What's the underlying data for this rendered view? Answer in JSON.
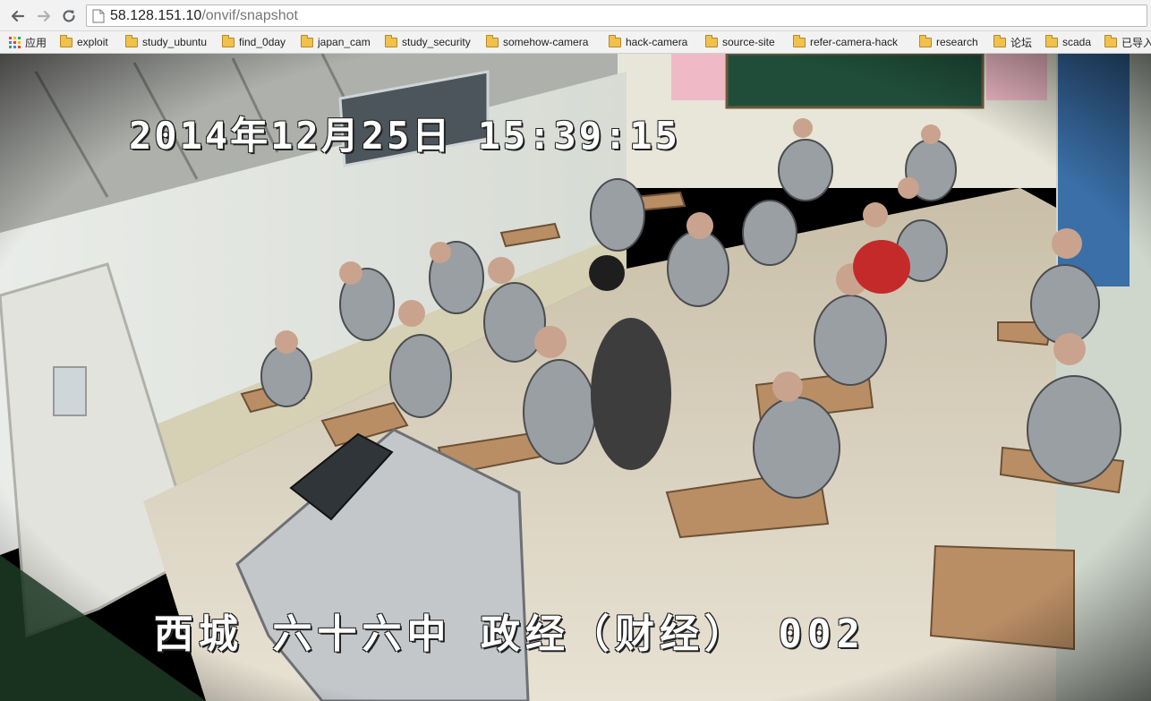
{
  "browser": {
    "url": {
      "host": "58.128.151.10",
      "path": "/onvif/snapshot"
    },
    "bookmarks": [
      {
        "label": "应用",
        "icon": "apps-icon"
      },
      {
        "label": "exploit",
        "icon": "folder-icon"
      },
      {
        "label": "study_ubuntu",
        "icon": "folder-icon"
      },
      {
        "label": "find_0day",
        "icon": "folder-icon"
      },
      {
        "label": "japan_cam",
        "icon": "folder-icon"
      },
      {
        "label": "study_security",
        "icon": "folder-icon"
      },
      {
        "label": "somehow-camera",
        "icon": "folder-icon"
      },
      {
        "label": "hack-camera",
        "icon": "folder-icon"
      },
      {
        "label": "source-site",
        "icon": "folder-icon"
      },
      {
        "label": "refer-camera-hack",
        "icon": "folder-icon"
      },
      {
        "label": "research",
        "icon": "folder-icon"
      },
      {
        "label": "论坛",
        "icon": "folder-icon"
      },
      {
        "label": "scada",
        "icon": "folder-icon"
      },
      {
        "label": "已导入",
        "icon": "folder-icon"
      }
    ]
  },
  "snapshot": {
    "timestamp_overlay": "2014年12月25日  15:39:15",
    "location_overlay": "西城 六十六中 政经（财经） 002"
  },
  "colors": {
    "toolbar_bg": "#f2f2f2",
    "omnibox_border": "#b9b9b9",
    "folder_yellow": "#f0c14b"
  }
}
